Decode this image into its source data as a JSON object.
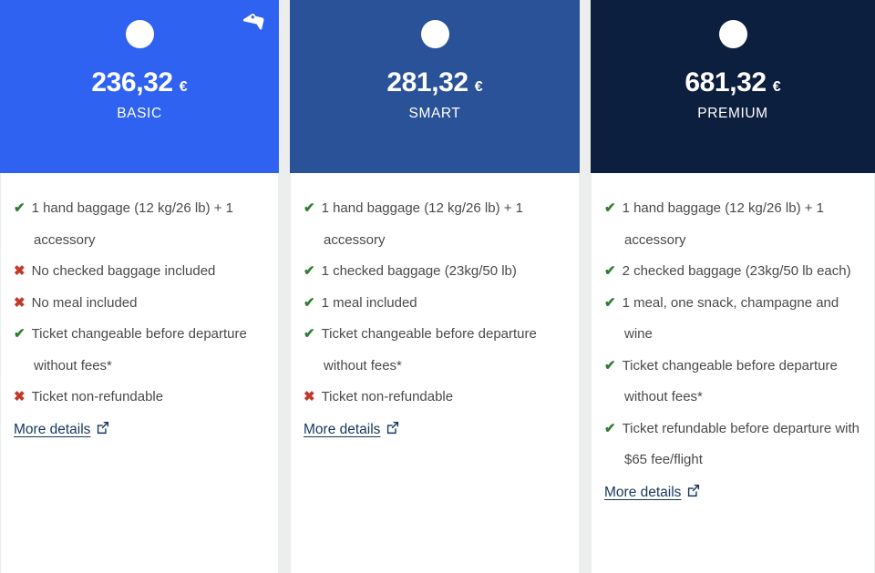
{
  "colors": {
    "basic_header_bg": "#2f62f0",
    "smart_header_bg": "#2a5298",
    "premium_header_bg": "#0d1f3f",
    "page_bg": "#eceded",
    "check_green": "#2f7d32",
    "cross_red": "#c0392b",
    "link_navy": "#17365d",
    "body_text": "#4a4a4a"
  },
  "fares": [
    {
      "id": "basic",
      "name": "BASIC",
      "price": "236,32",
      "currency": "€",
      "logo_icon": "airline-circle-logo-icon",
      "badge_icon": "price-tag-icon",
      "has_badge": true,
      "features": [
        {
          "mark": "yes",
          "text": "1 hand baggage (12 kg/26 lb) + 1 accessory"
        },
        {
          "mark": "no",
          "text": "No checked baggage included"
        },
        {
          "mark": "no",
          "text": "No meal included"
        },
        {
          "mark": "yes",
          "text": "Ticket changeable before departure without fees*"
        },
        {
          "mark": "no",
          "text": "Ticket non-refundable"
        }
      ],
      "more_details_label": "More details",
      "more_details_icon": "external-link-icon"
    },
    {
      "id": "smart",
      "name": "SMART",
      "price": "281,32",
      "currency": "€",
      "logo_icon": "airline-circle-logo-icon",
      "has_badge": false,
      "features": [
        {
          "mark": "yes",
          "text": "1 hand baggage (12 kg/26 lb) + 1 accessory"
        },
        {
          "mark": "yes",
          "text": "1 checked baggage (23kg/50 lb)"
        },
        {
          "mark": "yes",
          "text": "1 meal included"
        },
        {
          "mark": "yes",
          "text": "Ticket changeable before departure without fees*"
        },
        {
          "mark": "no",
          "text": "Ticket non-refundable"
        }
      ],
      "more_details_label": "More details",
      "more_details_icon": "external-link-icon"
    },
    {
      "id": "premium",
      "name": "PREMIUM",
      "price": "681,32",
      "currency": "€",
      "logo_icon": "airline-circle-logo-icon",
      "has_badge": false,
      "features": [
        {
          "mark": "yes",
          "text": "1 hand baggage (12 kg/26 lb) + 1 accessory"
        },
        {
          "mark": "yes",
          "text": "2 checked baggage (23kg/50 lb each)"
        },
        {
          "mark": "yes",
          "text": "1 meal, one snack, champagne and wine"
        },
        {
          "mark": "yes",
          "text": "Ticket changeable before departure without fees*"
        },
        {
          "mark": "yes",
          "text": "Ticket refundable before departure with $65 fee/flight"
        }
      ],
      "more_details_label": "More details",
      "more_details_icon": "external-link-icon"
    }
  ],
  "marks": {
    "yes": "✔",
    "no": "✖"
  }
}
